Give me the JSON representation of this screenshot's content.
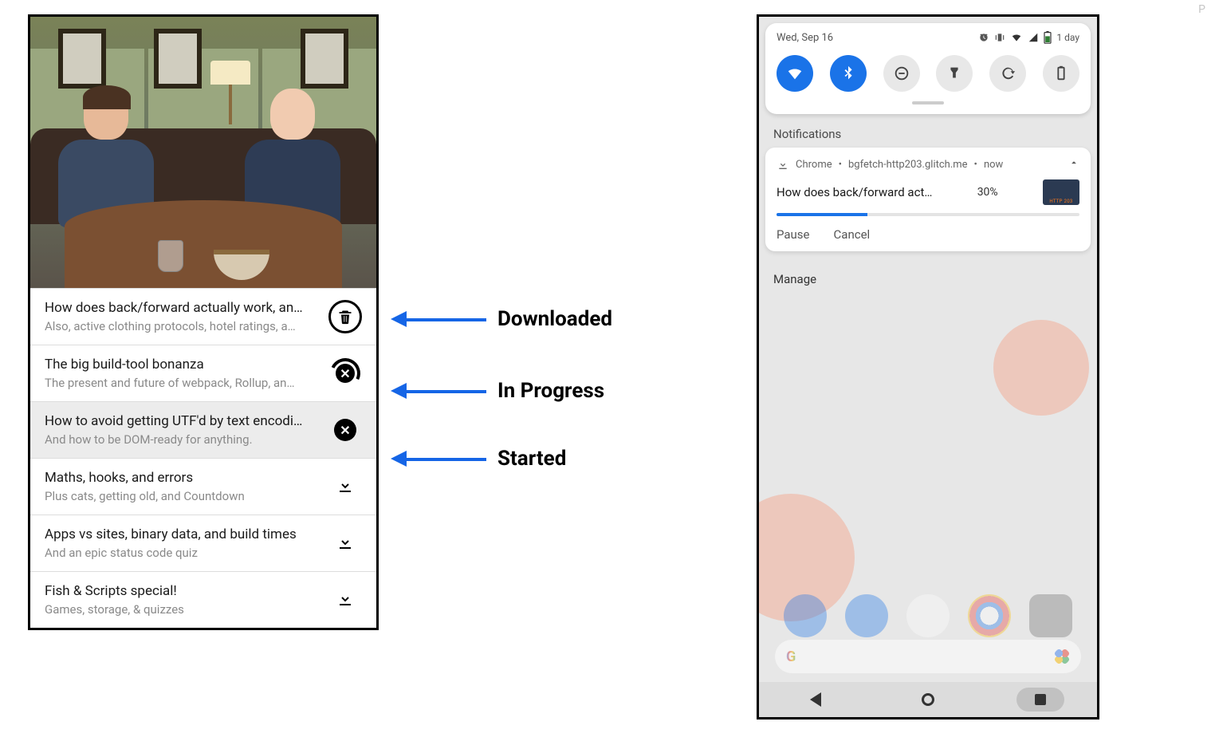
{
  "annotations": {
    "downloaded": "Downloaded",
    "in_progress": "In Progress",
    "started": "Started"
  },
  "left": {
    "items": [
      {
        "title": "How does back/forward actually work, an…",
        "subtitle": "Also, active clothing protocols, hotel ratings, a…",
        "state": "downloaded"
      },
      {
        "title": "The big build-tool bonanza",
        "subtitle": "The present and future of webpack, Rollup, an…",
        "state": "in_progress"
      },
      {
        "title": "How to avoid getting UTF'd by text encodi…",
        "subtitle": "And how to be DOM-ready for anything.",
        "state": "started"
      },
      {
        "title": "Maths, hooks, and errors",
        "subtitle": "Plus cats, getting old, and Countdown",
        "state": "idle"
      },
      {
        "title": "Apps vs sites, binary data, and build times",
        "subtitle": "And an epic status code quiz",
        "state": "idle"
      },
      {
        "title": "Fish & Scripts special!",
        "subtitle": "Games, storage, & quizzes",
        "state": "idle"
      }
    ]
  },
  "right": {
    "status": {
      "date": "Wed, Sep 16",
      "battery_text": "1 day"
    },
    "section_notifications": "Notifications",
    "notification": {
      "app": "Chrome",
      "source": "bgfetch-http203.glitch.me",
      "time": "now",
      "title": "How does back/forward act…",
      "percent_text": "30%",
      "percent": 30,
      "actions": {
        "pause": "Pause",
        "cancel": "Cancel"
      }
    },
    "manage": "Manage"
  },
  "corner": "P"
}
